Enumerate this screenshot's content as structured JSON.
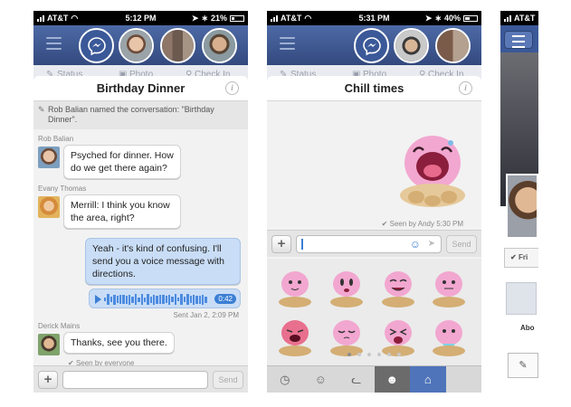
{
  "phone1": {
    "status": {
      "carrier": "AT&T",
      "time": "5:12 PM",
      "battery": "21%",
      "battery_level": 0.21
    },
    "subbar": {
      "status_label": "Status",
      "photo_label": "Photo",
      "checkin_label": "Check In"
    },
    "chat": {
      "title": "Birthday Dinner",
      "system_message": "Rob Balian named the conversation: \"Birthday Dinner\".",
      "messages": [
        {
          "sender": "Rob Balian",
          "text": "Psyched for dinner. How do we get there again?"
        },
        {
          "sender": "Evany Thomas",
          "text": "Merrill: I think you know the area, right?"
        },
        {
          "sender": "",
          "text": "Yeah - it's kind of confusing. I'll send you a voice message with directions."
        },
        {
          "sender": "Derick Mains",
          "text": "Thanks, see you there."
        }
      ],
      "audio_duration": "0:42",
      "sent_meta": "Sent Jan 2, 2:09 PM",
      "seen": "Seen by everyone",
      "send_label": "Send"
    }
  },
  "phone2": {
    "status": {
      "carrier": "AT&T",
      "time": "5:31 PM",
      "battery": "40%",
      "battery_level": 0.4
    },
    "subbar": {
      "status_label": "Status",
      "photo_label": "Photo",
      "checkin_label": "Check In"
    },
    "chat": {
      "title": "Chill times",
      "seen": "Seen by Andy 5:30 PM",
      "send_label": "Send"
    },
    "sticker_pages": 6,
    "sticker_page_active": 1
  },
  "phone3": {
    "status": {
      "carrier": "AT&T"
    },
    "friends_label": "Fri",
    "about_label": "Abo"
  },
  "colors": {
    "facebook_blue": "#3b5998",
    "bubble_blue": "#c9ddf6",
    "sticker_pink": "#f2a7d0"
  }
}
